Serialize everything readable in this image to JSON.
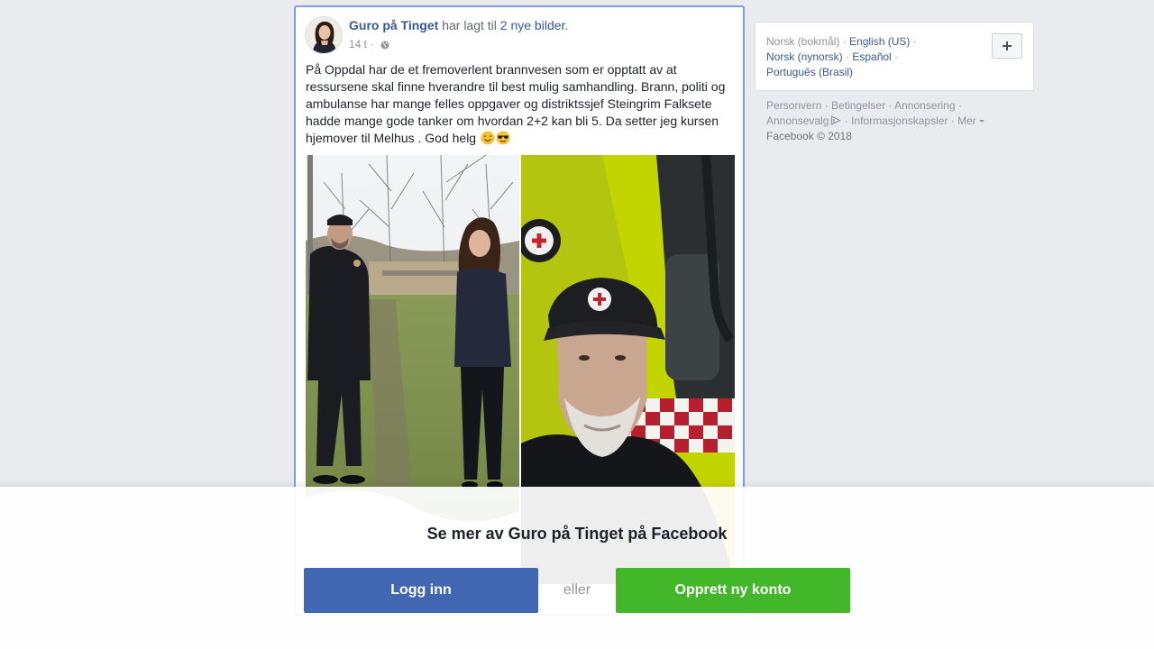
{
  "post": {
    "author": "Guro på Tinget",
    "action_text": " har lagt til ",
    "action_link": "2 nye bilder",
    "action_end": ".",
    "time": "14 t",
    "meta_sep": " · ",
    "privacy_icon": "globe-icon",
    "text": "På Oppdal har de et fremoverlent brannvesen som er opptatt av at ressursene skal finne hverandre til best mulig samhandling. Brann, politi og ambulanse har mange felles oppgaver og distriktssjef Steingrim Falksete hadde mange gode tanker om hvordan 2+2 kan bli 5. Da setter jeg kursen hjemover til Melhus . God helg",
    "emojis": [
      "smiling-face-icon",
      "sunglasses-face-icon"
    ]
  },
  "languages": {
    "current": "Norsk (bokmål)",
    "items": [
      "English (US)",
      "Norsk (nynorsk)",
      "Español",
      "Português (Brasil)"
    ],
    "separator": " · ",
    "add_icon": "plus-icon"
  },
  "footer": {
    "links": [
      "Personvern",
      "Betingelser",
      "Annonsering",
      "Annonsevalg",
      "Informasjonskapsler",
      "Mer"
    ],
    "separator": " · ",
    "copyright": "Facebook © 2018"
  },
  "login_bar": {
    "title": "Se mer av Guro på Tinget på Facebook",
    "login_label": "Logg inn",
    "or_label": "eller",
    "create_label": "Opprett ny konto"
  },
  "colors": {
    "brand_blue": "#4267b2",
    "link_blue": "#385898",
    "create_green": "#42b72a",
    "page_bg": "#e9ebee"
  }
}
